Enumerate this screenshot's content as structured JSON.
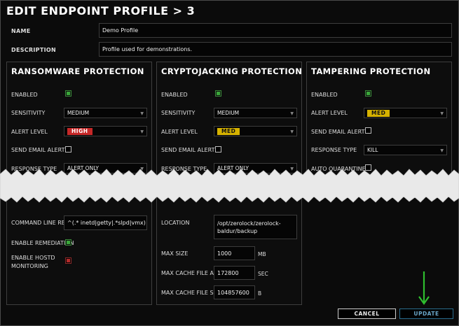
{
  "title": "EDIT ENDPOINT PROFILE  > 3",
  "name": {
    "label": "NAME",
    "value": "Demo Profile"
  },
  "description": {
    "label": "DESCRIPTION",
    "value": "Profile used for demonstrations."
  },
  "ransomware": {
    "title": "RANSOMWARE PROTECTION",
    "enabled_label": "ENABLED",
    "sensitivity_label": "SENSITIVITY",
    "sensitivity_value": "MEDIUM",
    "alert_level_label": "ALERT LEVEL",
    "alert_level_value": "HIGH",
    "send_email_label": "SEND EMAIL ALERTS",
    "response_type_label": "RESPONSE TYPE",
    "response_type_value": "ALERT ONLY"
  },
  "cryptojacking": {
    "title": "CRYPTOJACKING PROTECTION",
    "enabled_label": "ENABLED",
    "sensitivity_label": "SENSITIVITY",
    "sensitivity_value": "MEDIUM",
    "alert_level_label": "ALERT LEVEL",
    "alert_level_value": "MED",
    "send_email_label": "SEND EMAIL ALERTS",
    "response_type_label": "RESPONSE TYPE",
    "response_type_value": "ALERT ONLY"
  },
  "tampering": {
    "title": "TAMPERING PROTECTION",
    "enabled_label": "ENABLED",
    "alert_level_label": "ALERT LEVEL",
    "alert_level_value": "MED",
    "send_email_label": "SEND EMAIL ALERTS",
    "response_type_label": "RESPONSE TYPE",
    "response_type_value": "KILL",
    "auto_quarantine_label": "AUTO QUARANTINE"
  },
  "lower_left": {
    "cmd_regex_label": "COMMAND LINE REGEX",
    "cmd_regex_value": "^(.* inetd|getty|.*slpd|vmx) .*$",
    "enable_remediation_label": "ENABLE REMEDIATION",
    "enable_hostd_label_1": "ENABLE HOSTD",
    "enable_hostd_label_2": "MONITORING"
  },
  "lower_mid": {
    "location_label": "LOCATION",
    "location_value_1": "/opt/zerolock/zerolock-",
    "location_value_2": "baldur/backup",
    "max_size_label": "MAX SIZE",
    "max_size_value": "1000",
    "max_size_unit": "MB",
    "max_cache_age_label": "MAX CACHE FILE AGE",
    "max_cache_age_value": "172800",
    "max_cache_age_unit": "SEC",
    "max_cache_size_label": "MAX CACHE FILE SIZE",
    "max_cache_size_value": "104857600",
    "max_cache_size_unit": "B"
  },
  "buttons": {
    "cancel": "CANCEL",
    "update": "UPDATE"
  },
  "colors": {
    "accent_green": "#3aa83a",
    "badge_high": "#c62828",
    "badge_med": "#d6b200",
    "update_blue": "#2a6d8f",
    "arrow_green": "#2fbf2f"
  }
}
